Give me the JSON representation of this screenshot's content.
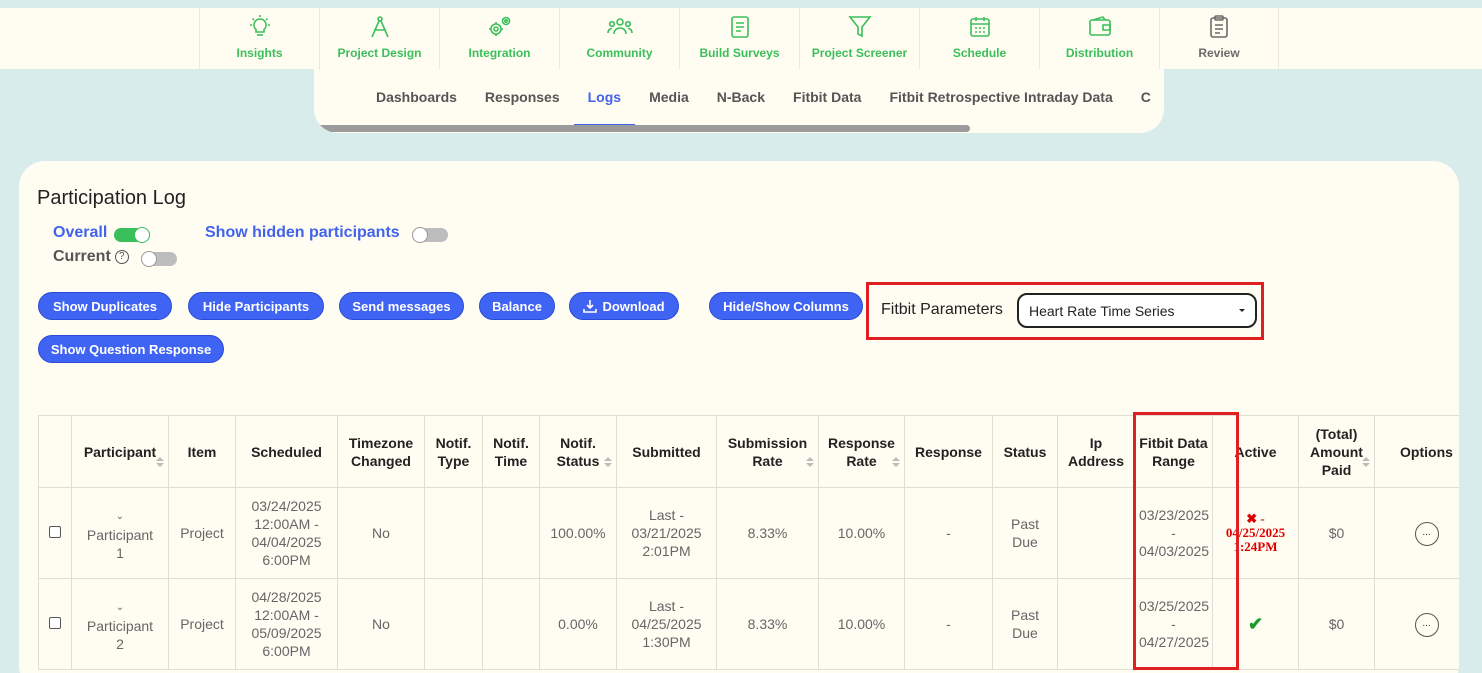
{
  "topnav": {
    "items": [
      {
        "label": "Insights",
        "icon": "lightbulb-icon"
      },
      {
        "label": "Project Design",
        "icon": "compass-icon"
      },
      {
        "label": "Integration",
        "icon": "gears-icon"
      },
      {
        "label": "Community",
        "icon": "people-icon"
      },
      {
        "label": "Build Surveys",
        "icon": "document-icon"
      },
      {
        "label": "Project Screener",
        "icon": "filter-icon"
      },
      {
        "label": "Schedule",
        "icon": "calendar-icon"
      },
      {
        "label": "Distribution",
        "icon": "wallet-icon"
      },
      {
        "label": "Review",
        "icon": "clipboard-icon"
      }
    ],
    "accent": "#3bbf5a"
  },
  "subtabs": {
    "items": [
      "Dashboards",
      "Responses",
      "Logs",
      "Media",
      "N-Back",
      "Fitbit Data",
      "Fitbit Retrospective Intraday Data",
      "C"
    ],
    "active": "Logs"
  },
  "main": {
    "title": "Participation Log",
    "toggles": {
      "overall": "Overall",
      "current": "Current",
      "current_help": "?",
      "show_hidden": "Show hidden participants"
    },
    "buttons": {
      "show_duplicates": "Show Duplicates",
      "hide_participants": "Hide Participants",
      "send_messages": "Send messages",
      "balance": "Balance",
      "download": "Download",
      "hide_show_columns": "Hide/Show Columns",
      "show_question_response": "Show Question Response"
    },
    "fitbit": {
      "label": "Fitbit Parameters",
      "selected": "Heart Rate Time Series"
    }
  },
  "table": {
    "headers": {
      "participant": "Participant",
      "item": "Item",
      "scheduled": "Scheduled",
      "timezone_1": "Timezone",
      "timezone_2": "Changed",
      "notif_type_1": "Notif.",
      "notif_type_2": "Type",
      "notif_time_1": "Notif.",
      "notif_time_2": "Time",
      "notif_status_1": "Notif.",
      "notif_status_2": "Status",
      "submitted": "Submitted",
      "submission_rate_1": "Submission",
      "submission_rate_2": "Rate",
      "response_rate_1": "Response",
      "response_rate_2": "Rate",
      "response": "Response",
      "status": "Status",
      "ip_1": "Ip",
      "ip_2": "Address",
      "fitbit_range_1": "Fitbit Data",
      "fitbit_range_2": "Range",
      "active": "Active",
      "amount_1": "(Total)",
      "amount_2": "Amount",
      "amount_3": "Paid",
      "options": "Options"
    },
    "rows": [
      {
        "participant_1": "Participant",
        "participant_2": "1",
        "item": "Project",
        "scheduled_1": "03/24/2025",
        "scheduled_2": "12:00AM -",
        "scheduled_3": "04/04/2025",
        "scheduled_4": "6:00PM",
        "timezone": "No",
        "notif_status": "100.00%",
        "submitted_1": "Last -",
        "submitted_2": "03/21/2025",
        "submitted_3": "2:01PM",
        "submission_rate": "8.33%",
        "response_rate": "10.00%",
        "response": "-",
        "status_1": "Past",
        "status_2": "Due",
        "range_1": "03/23/2025",
        "range_2": "-",
        "range_3": "04/03/2025",
        "active_1": "✖ -",
        "active_2": "04/25/2025",
        "active_3": "1:24PM",
        "amount": "$0",
        "options": "..."
      },
      {
        "participant_1": "Participant",
        "participant_2": "2",
        "item": "Project",
        "scheduled_1": "04/28/2025",
        "scheduled_2": "12:00AM -",
        "scheduled_3": "05/09/2025",
        "scheduled_4": "6:00PM",
        "timezone": "No",
        "notif_status": "0.00%",
        "submitted_1": "Last -",
        "submitted_2": "04/25/2025",
        "submitted_3": "1:30PM",
        "submission_rate": "8.33%",
        "response_rate": "10.00%",
        "response": "-",
        "status_1": "Past",
        "status_2": "Due",
        "range_1": "03/25/2025",
        "range_2": "-",
        "range_3": "04/27/2025",
        "active_1": "✔",
        "amount": "$0",
        "options": "..."
      }
    ]
  }
}
